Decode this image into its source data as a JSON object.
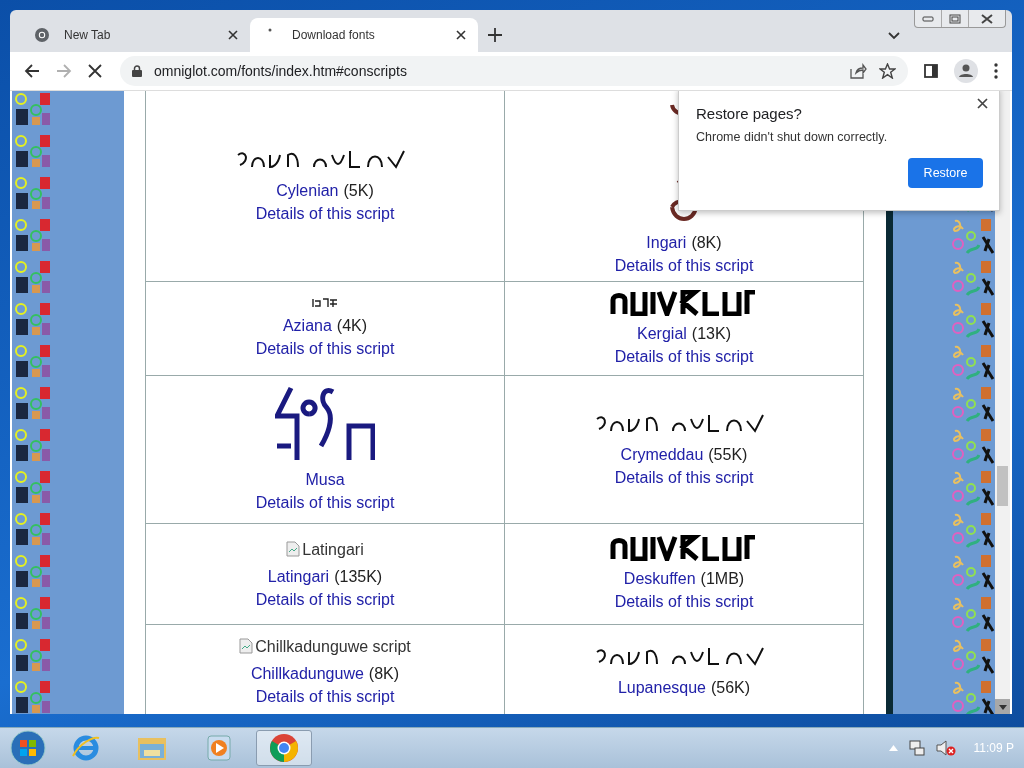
{
  "tabs": [
    {
      "title": "New Tab",
      "selected": false,
      "loading": false
    },
    {
      "title": "Download fonts",
      "selected": true,
      "loading": true
    }
  ],
  "toolbar": {
    "url": "omniglot.com/fonts/index.htm#conscripts",
    "forward_disabled": true,
    "loading": true
  },
  "popup": {
    "title": "Restore pages?",
    "message": "Chrome didn't shut down correctly.",
    "button": "Restore"
  },
  "font_rows": [
    [
      {
        "kind": "wide",
        "name": "Cylenian",
        "size": "(5K)",
        "details": "Details of this script"
      },
      {
        "kind": "tall",
        "name": "Ingari",
        "size": "(8K)",
        "details": "Details of this script"
      }
    ],
    [
      {
        "kind": "small",
        "name": "Aziana",
        "size": "(4K)",
        "details": "Details of this script"
      },
      {
        "kind": "bold",
        "name": "Kergial",
        "size": "(13K)",
        "details": "Details of this script"
      }
    ],
    [
      {
        "kind": "big",
        "name": "Musa",
        "details": "Details of this script"
      },
      {
        "kind": "wide",
        "name": "Crymeddau",
        "size": "(55K)",
        "details": "Details of this script"
      }
    ],
    [
      {
        "kind": "broken",
        "alt": "Latingari",
        "name": "Latingari",
        "size": "(135K)",
        "details": "Details of this script"
      },
      {
        "kind": "bold",
        "name": "Deskuffen",
        "size": "(1MB)",
        "details": "Details of this script"
      }
    ],
    [
      {
        "kind": "broken",
        "alt": "Chillkadunguwe script",
        "name": "Chillkadunguwe",
        "size": "(8K)",
        "details": "Details of this script"
      },
      {
        "kind": "wide",
        "name": "Lupanesque",
        "size": "(56K)"
      }
    ]
  ],
  "taskbar": {
    "clock": "11:09 P",
    "volume_muted": true
  }
}
